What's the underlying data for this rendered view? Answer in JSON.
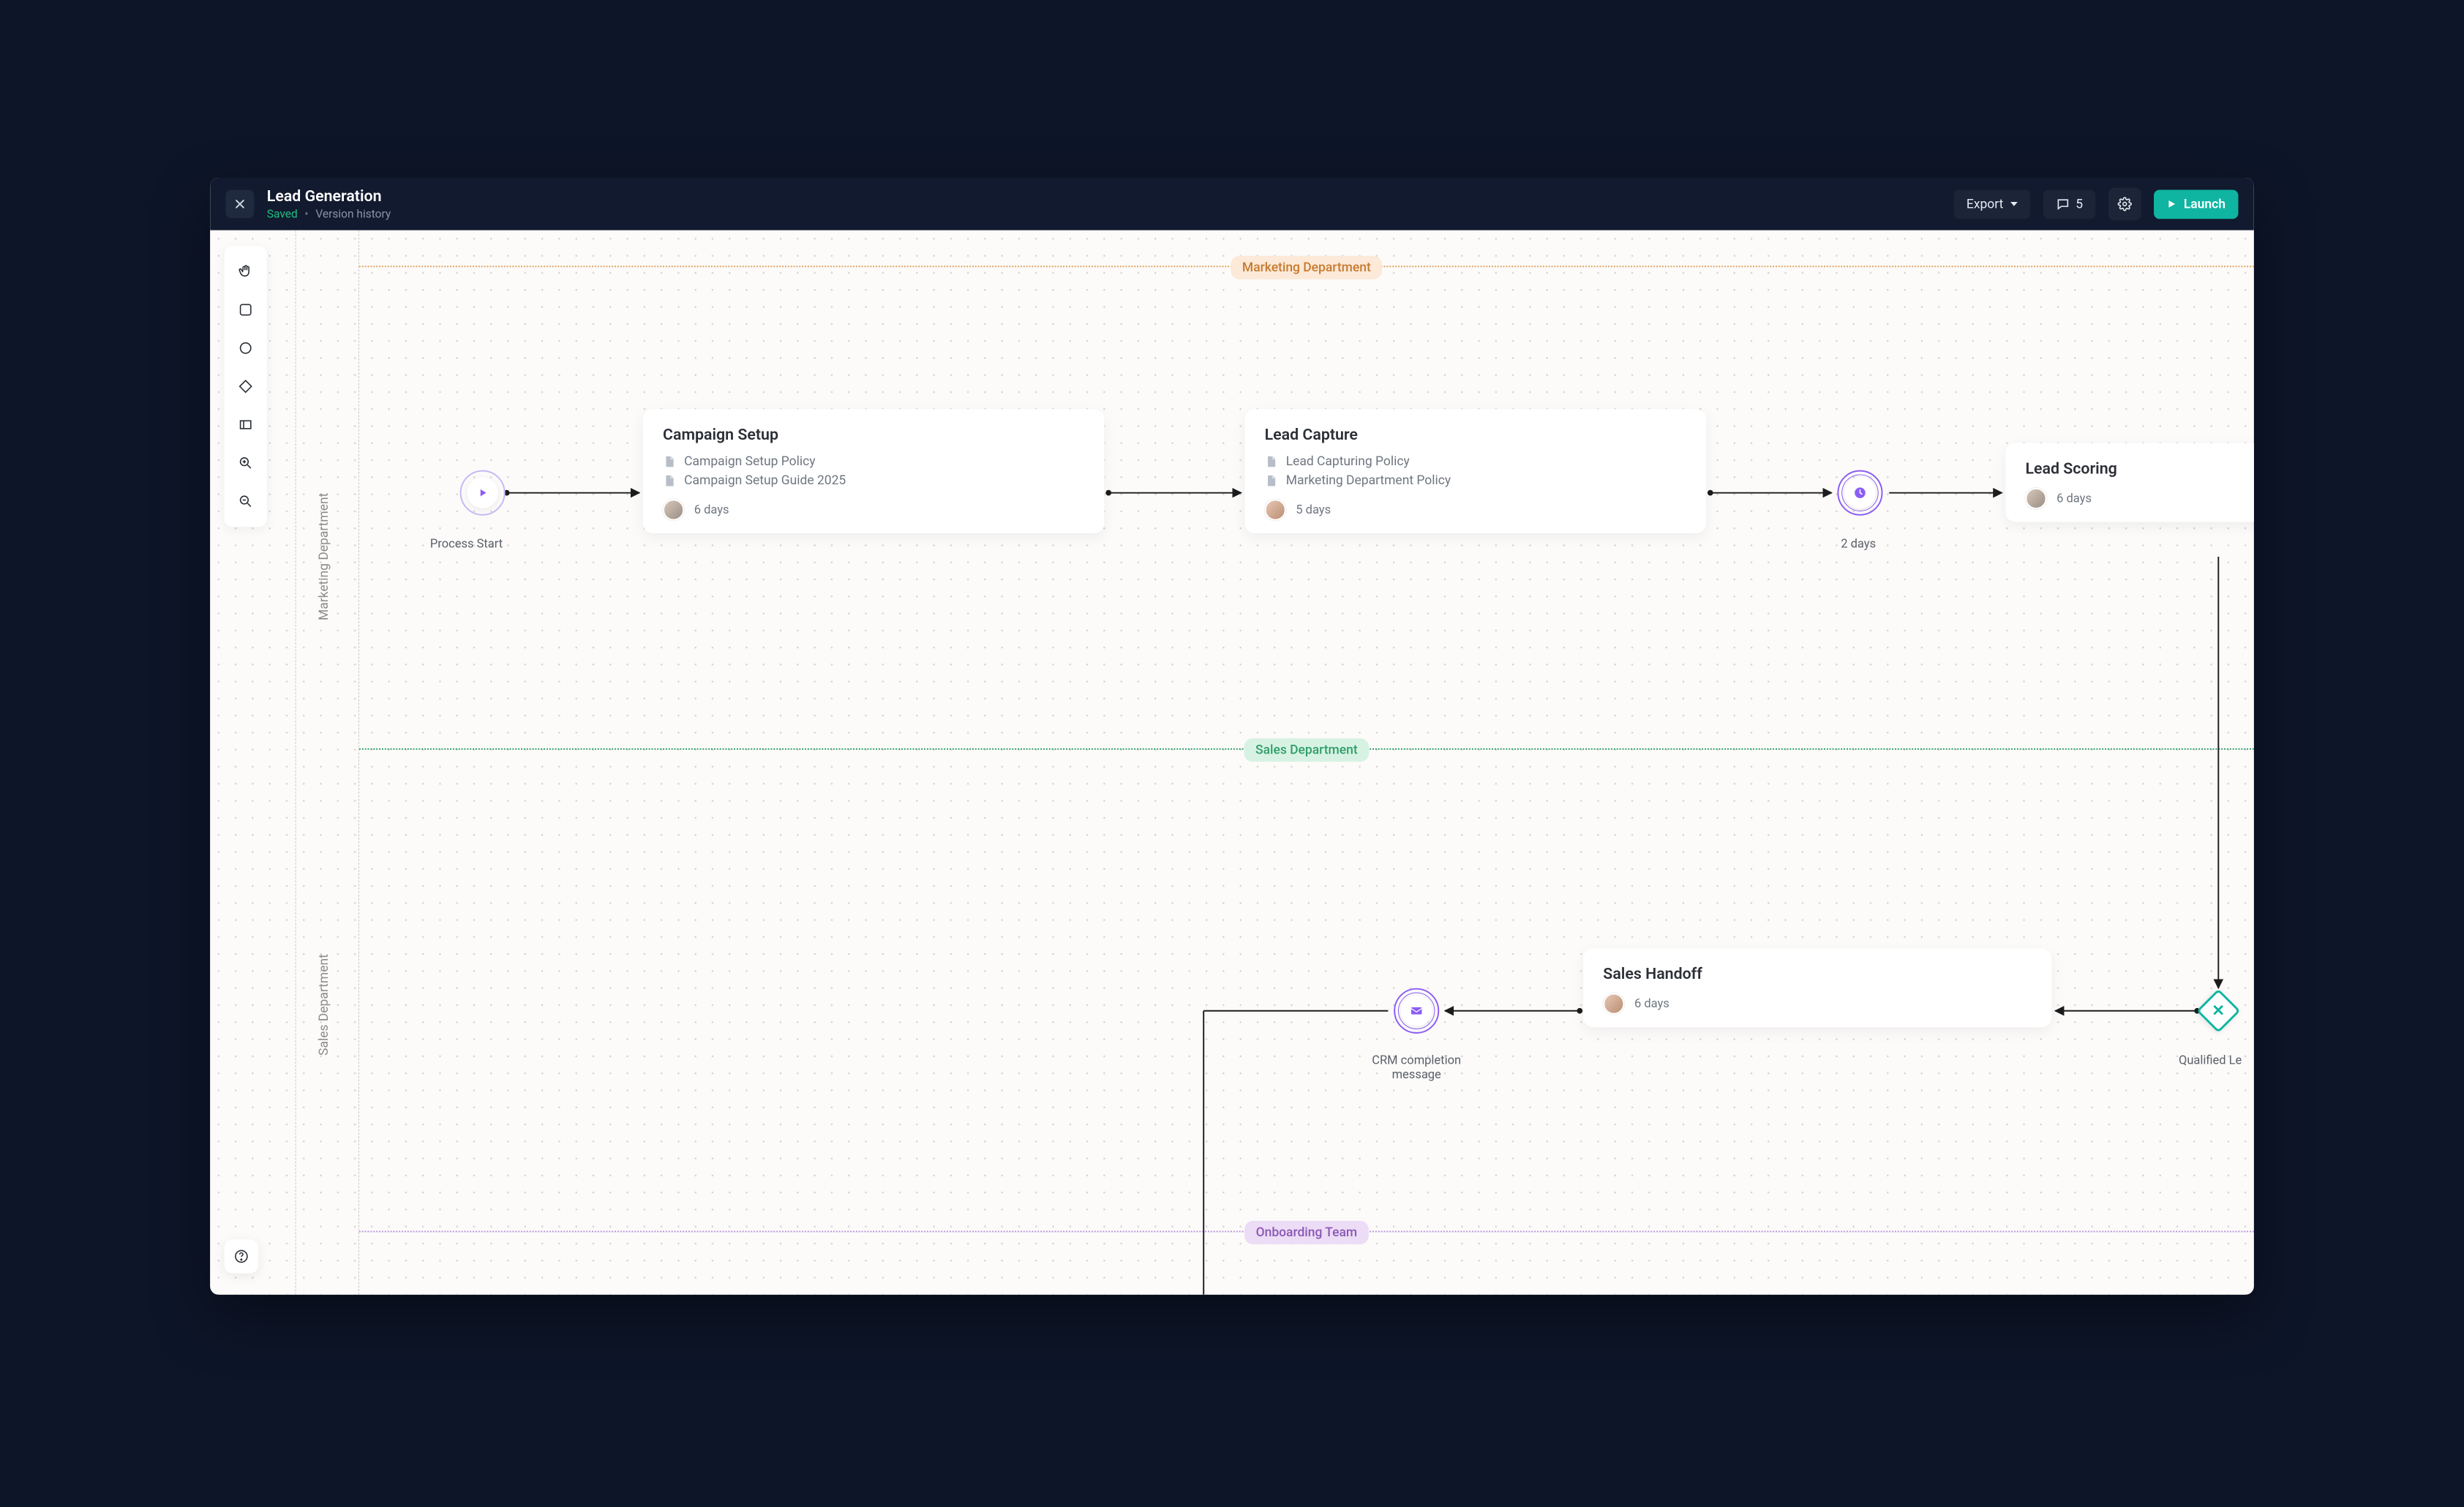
{
  "header": {
    "title": "Lead Generation",
    "saved_label": "Saved",
    "version_history_label": "Version history",
    "export_label": "Export",
    "comment_count": "5",
    "launch_label": "Launch"
  },
  "swimlanes": [
    {
      "id": "marketing",
      "label": "Marketing Department",
      "tag_bg": "#fce9d7",
      "tag_color": "#c77a2f",
      "divider_color": "#e2a15e"
    },
    {
      "id": "sales",
      "label": "Sales Department",
      "tag_bg": "#d7f2e3",
      "tag_color": "#2f9e6a",
      "divider_color": "#2f9e6a"
    },
    {
      "id": "onboarding",
      "label": "Onboarding Team",
      "tag_bg": "#ecdcf5",
      "tag_color": "#8a57b6",
      "divider_color": "#b98fd6"
    }
  ],
  "flow": {
    "start": {
      "label": "Process Start"
    },
    "timer": {
      "label": "2 days"
    },
    "message": {
      "label": "CRM completion message"
    },
    "gateway": {
      "label": "Qualified Le"
    },
    "cards": {
      "campaign_setup": {
        "title": "Campaign Setup",
        "docs": [
          "Campaign Setup Policy",
          "Campaign Setup Guide 2025"
        ],
        "duration": "6 days"
      },
      "lead_capture": {
        "title": "Lead Capture",
        "docs": [
          "Lead Capturing Policy",
          "Marketing Department Policy"
        ],
        "duration": "5 days"
      },
      "lead_scoring": {
        "title": "Lead Scoring",
        "docs": [],
        "duration": "6 days"
      },
      "sales_handoff": {
        "title": "Sales Handoff",
        "docs": [],
        "duration": "6 days"
      }
    }
  },
  "colors": {
    "accent_teal": "#0fb5a1",
    "accent_purple": "#8b5cf6"
  }
}
